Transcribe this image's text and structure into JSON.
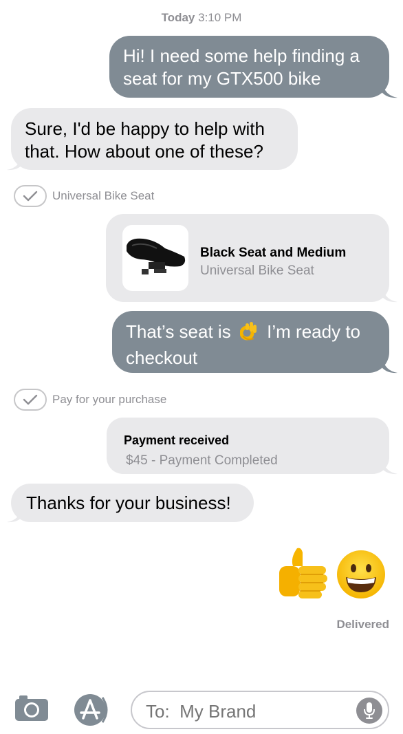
{
  "header": {
    "day": "Today",
    "time": "3:10 PM"
  },
  "messages": {
    "m1": {
      "line1": "Hi! I need some help finding a",
      "line2": "seat for my GTX500 bike"
    },
    "m2": {
      "line1": "Sure, I'd be happy to help with",
      "line2": "that.  How about one of these?"
    },
    "m3": {
      "line1_a": "That’s seat is",
      "line1_b": "I’m ready to",
      "line2": "checkout"
    },
    "m4": {
      "text": "Thanks for your business!"
    }
  },
  "checks": {
    "product": "Universal Bike Seat",
    "payment": "Pay for your purchase"
  },
  "product_card": {
    "title": "Black Seat and Medium",
    "subtitle": "Universal Bike Seat"
  },
  "payment_card": {
    "title": "Payment received",
    "subtitle": "$45 - Payment Completed"
  },
  "status": {
    "delivered": "Delivered"
  },
  "composer": {
    "placeholder": "To:  My Brand"
  },
  "icons": {
    "camera": "camera-icon",
    "appstore": "app-store-icon",
    "mic": "microphone-icon",
    "thumbs": "thumbs-up-emoji",
    "smile": "grinning-face-emoji",
    "ok": "ok-hand-emoji"
  },
  "colors": {
    "outgoing_bubble": "#808b94",
    "incoming_bubble": "#e9e9eb",
    "secondary_text": "#8e8e93"
  }
}
